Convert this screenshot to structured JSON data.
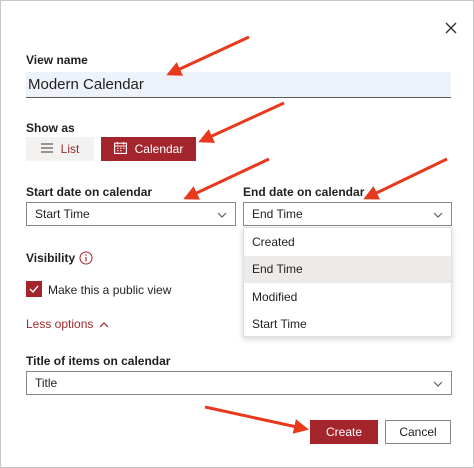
{
  "dialog": {
    "view_name_label": "View name",
    "view_name_value": "Modern Calendar",
    "show_as_label": "Show as",
    "show_as_options": [
      {
        "label": "List",
        "icon": "list-icon",
        "selected": false
      },
      {
        "label": "Calendar",
        "icon": "calendar-icon",
        "selected": true
      }
    ],
    "start_date_label": "Start date on calendar",
    "start_date_value": "Start Time",
    "end_date_label": "End date on calendar",
    "end_date_value": "End Time",
    "end_date_options": [
      "Created",
      "End Time",
      "Modified",
      "Start Time"
    ],
    "end_date_highlighted": "End Time",
    "visibility_label": "Visibility",
    "public_view_label": "Make this a public view",
    "public_view_checked": true,
    "less_options_label": "Less options",
    "title_items_label": "Title of items on calendar",
    "title_items_value": "Title",
    "create_label": "Create",
    "cancel_label": "Cancel"
  },
  "colors": {
    "accent": "#a4262c",
    "annotation_arrow": "#e8391d",
    "input_bg": "#eef2fb"
  }
}
